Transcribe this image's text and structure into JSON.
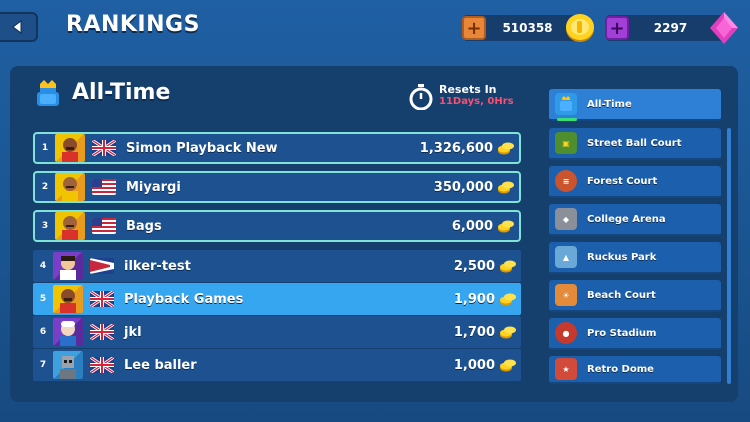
{
  "header": {
    "title": "RANKINGS"
  },
  "currency": {
    "coins": "510358",
    "gems": "2297"
  },
  "leaderboard": {
    "title": "All-Time",
    "reset_label": "Resets In",
    "reset_time": "11Days, 0Hrs",
    "rows": [
      {
        "rank": "1",
        "name": "Simon Playback New",
        "score": "1,326,600",
        "flag": "uk"
      },
      {
        "rank": "2",
        "name": "Miyargi",
        "score": "350,000",
        "flag": "us"
      },
      {
        "rank": "3",
        "name": "Bags",
        "score": "6,000",
        "flag": "us"
      },
      {
        "rank": "4",
        "name": "ilker-test",
        "score": "2,500",
        "flag": "pennant"
      },
      {
        "rank": "5",
        "name": "Playback Games",
        "score": "1,900",
        "flag": "uk"
      },
      {
        "rank": "6",
        "name": "jkl",
        "score": "1,700",
        "flag": "uk"
      },
      {
        "rank": "7",
        "name": "Lee baller",
        "score": "1,000",
        "flag": "uk"
      }
    ]
  },
  "courts": [
    {
      "name": "All-Time",
      "icon": "trophy-player-icon",
      "color": "#2e9ae8"
    },
    {
      "name": "Street Ball Court",
      "icon": "street-court-icon",
      "color": "#4e8e2e"
    },
    {
      "name": "Forest Court",
      "icon": "forest-court-icon",
      "color": "#c9542e"
    },
    {
      "name": "College Arena",
      "icon": "college-arena-icon",
      "color": "#8a8f99"
    },
    {
      "name": "Ruckus Park",
      "icon": "ruckus-park-icon",
      "color": "#6aa8d8"
    },
    {
      "name": "Beach Court",
      "icon": "beach-court-icon",
      "color": "#e38a3b"
    },
    {
      "name": "Pro Stadium",
      "icon": "pro-stadium-icon",
      "color": "#c63a2e"
    },
    {
      "name": "Retro Dome",
      "icon": "retro-dome-icon",
      "color": "#d24a3a"
    }
  ]
}
